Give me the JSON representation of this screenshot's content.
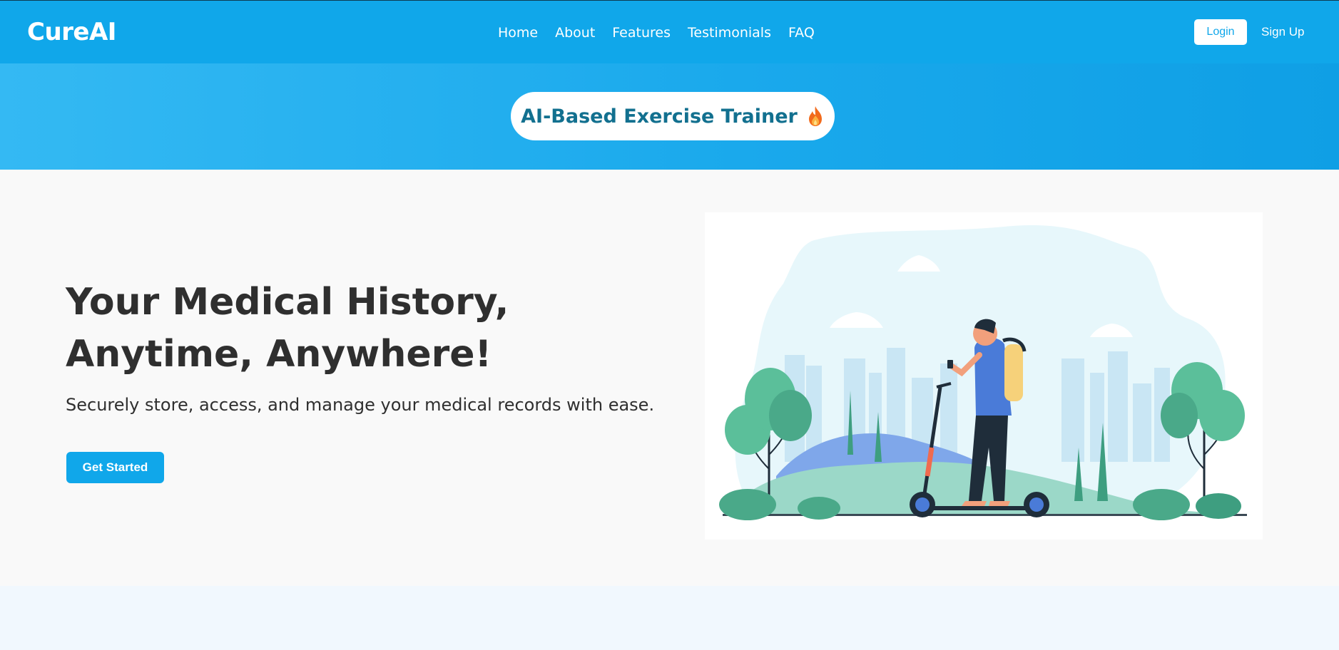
{
  "brand": {
    "name": "CureAI"
  },
  "nav": {
    "links": [
      "Home",
      "About",
      "Features",
      "Testimonials",
      "FAQ"
    ],
    "login_label": "Login",
    "signup_label": "Sign Up"
  },
  "promo": {
    "label": "AI-Based Exercise Trainer",
    "icon": "fire-icon"
  },
  "hero": {
    "title": "Your Medical History, Anytime, Anywhere!",
    "subtitle": "Securely store, access, and manage your medical records with ease.",
    "cta_label": "Get Started",
    "illustration": "person-on-scooter-illustration"
  },
  "colors": {
    "primary": "#10a7ea",
    "promo_text": "#12708f",
    "heading": "#2f2f2f",
    "page_bg": "#f9f9f9"
  }
}
